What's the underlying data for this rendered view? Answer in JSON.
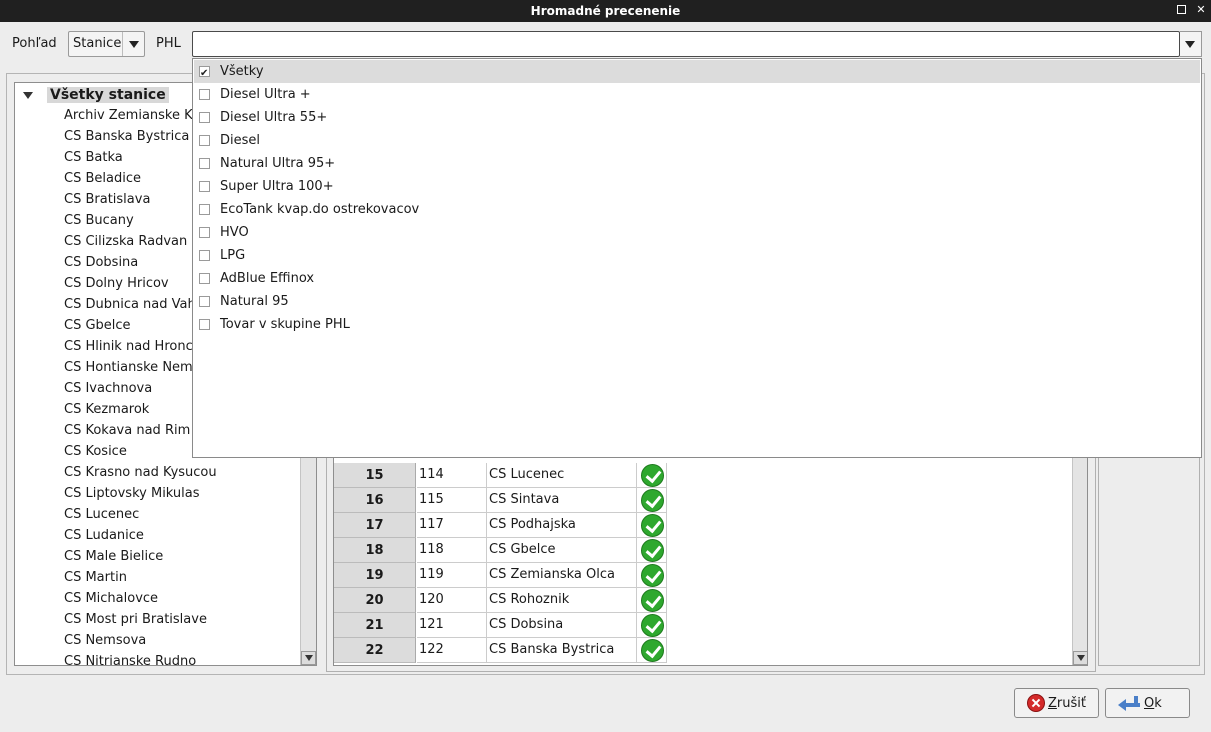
{
  "window": {
    "title": "Hromadné precenenie"
  },
  "toolbar": {
    "view_label": "Pohľad",
    "view_value": "Stanice",
    "phl_label": "PHL",
    "phl_value": ""
  },
  "tree": {
    "root": "Všetky stanice",
    "items": [
      "Archiv Zemianske K",
      "CS Banska Bystrica",
      "CS Batka",
      "CS Beladice",
      "CS Bratislava",
      "CS Bucany",
      "CS Cilizska Radvan",
      "CS Dobsina",
      "CS Dolny Hricov",
      "CS Dubnica nad Vah",
      "CS Gbelce",
      "CS Hlinik nad Hronc",
      "CS Hontianske Nem",
      "CS Ivachnova",
      "CS Kezmarok",
      "CS Kokava nad Rim",
      "CS Kosice",
      "CS Krasno nad Kysucou",
      "CS Liptovsky Mikulas",
      "CS Lucenec",
      "CS Ludanice",
      "CS Male Bielice",
      "CS Martin",
      "CS Michalovce",
      "CS Most pri Bratislave",
      "CS Nemsova",
      "CS Nitrianske Rudno"
    ]
  },
  "phl_dropdown": {
    "items": [
      {
        "label": "Všetky",
        "checked": true
      },
      {
        "label": "Diesel Ultra +",
        "checked": false
      },
      {
        "label": "Diesel Ultra 55+",
        "checked": false
      },
      {
        "label": "Diesel",
        "checked": false
      },
      {
        "label": "Natural Ultra 95+",
        "checked": false
      },
      {
        "label": "Super Ultra 100+",
        "checked": false
      },
      {
        "label": "EcoTank kvap.do ostrekovacov",
        "checked": false
      },
      {
        "label": "HVO",
        "checked": false
      },
      {
        "label": "LPG",
        "checked": false
      },
      {
        "label": "AdBlue  Effinox",
        "checked": false
      },
      {
        "label": "Natural 95",
        "checked": false
      },
      {
        "label": "Tovar v skupine PHL",
        "checked": false
      }
    ]
  },
  "table": {
    "rows": [
      {
        "num": "15",
        "code": "114",
        "name": "CS Lucenec",
        "status": "ok"
      },
      {
        "num": "16",
        "code": "115",
        "name": "CS Sintava",
        "status": "ok"
      },
      {
        "num": "17",
        "code": "117",
        "name": "CS Podhajska",
        "status": "ok"
      },
      {
        "num": "18",
        "code": "118",
        "name": "CS Gbelce",
        "status": "ok"
      },
      {
        "num": "19",
        "code": "119",
        "name": "CS Zemianska Olca",
        "status": "ok"
      },
      {
        "num": "20",
        "code": "120",
        "name": "CS Rohoznik",
        "status": "ok"
      },
      {
        "num": "21",
        "code": "121",
        "name": "CS Dobsina",
        "status": "ok"
      },
      {
        "num": "22",
        "code": "122",
        "name": "CS Banska Bystrica",
        "status": "ok"
      }
    ]
  },
  "buttons": {
    "cancel_prefix": "",
    "cancel_mnemonic": "Z",
    "cancel_rest": "rušiť",
    "ok_mnemonic": "O",
    "ok_rest": "k"
  },
  "icons": {
    "close": "close-icon",
    "maximize": "maximize-icon",
    "ok_status": "check-circle-icon",
    "cancel": "cancel-icon",
    "ok": "enter-arrow-icon"
  },
  "colors": {
    "titlebar": "#202020",
    "status_ok": "#2ea82e",
    "cancel_icon": "#d42a2a",
    "ok_icon": "#4a7fc8"
  }
}
